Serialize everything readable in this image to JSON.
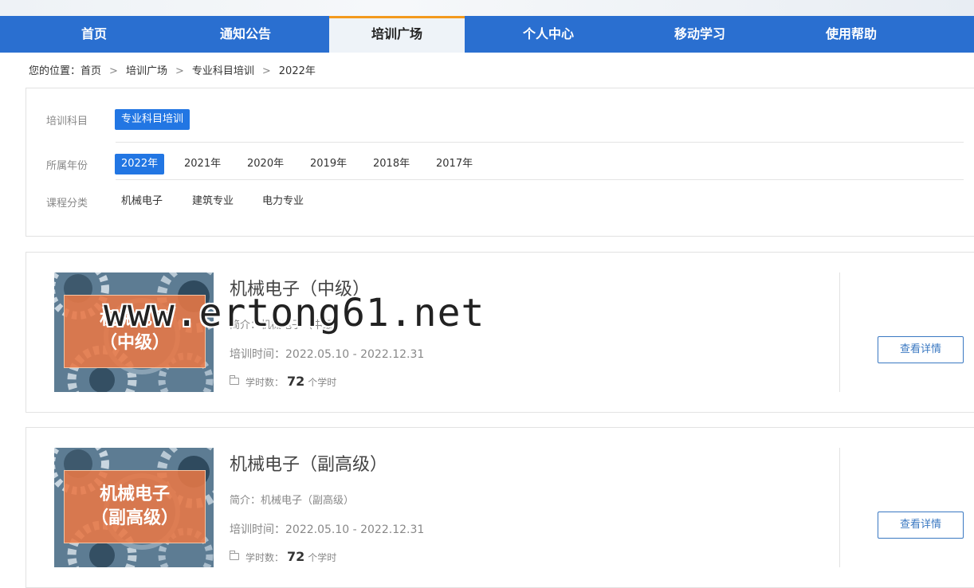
{
  "nav": {
    "items": [
      {
        "label": "首页"
      },
      {
        "label": "通知公告"
      },
      {
        "label": "培训广场"
      },
      {
        "label": "个人中心"
      },
      {
        "label": "移动学习"
      },
      {
        "label": "使用帮助"
      }
    ],
    "active_index": 2,
    "colors": {
      "bar": "#2a6fd0",
      "active_bg": "#eef3f8",
      "active_border": "#f39a1e"
    }
  },
  "breadcrumb": {
    "prefix": "您的位置：",
    "items": [
      "首页",
      "培训广场",
      "专业科目培训",
      "2022年"
    ],
    "separator": ">"
  },
  "filters": {
    "subject": {
      "label": "培训科目",
      "options": [
        "专业科目培训"
      ],
      "selected": "专业科目培训"
    },
    "year": {
      "label": "所属年份",
      "options": [
        "2022年",
        "2021年",
        "2020年",
        "2019年",
        "2018年",
        "2017年"
      ],
      "selected": "2022年"
    },
    "category": {
      "label": "课程分类",
      "options": [
        "机械电子",
        "建筑专业",
        "电力专业"
      ]
    },
    "active_color": "#2276e3"
  },
  "courses": [
    {
      "title": "机械电子（中级）",
      "thumb_line1": "机械电子",
      "thumb_line2": "（中级）",
      "desc": "简介：机械电子（中级）",
      "time": "培训时间：2022.05.10 - 2022.12.31",
      "hours_label": "学时数：",
      "hours": "72",
      "hours_unit": "个学时",
      "button": "查看详情"
    },
    {
      "title": "机械电子（副高级）",
      "thumb_line1": "机械电子",
      "thumb_line2": "（副高级）",
      "desc": "简介：机械电子（副高级）",
      "time": "培训时间：2022.05.10 - 2022.12.31",
      "hours_label": "学时数：",
      "hours": "72",
      "hours_unit": "个学时",
      "button": "查看详情"
    }
  ],
  "watermark": "www.ertong61.net",
  "icons": {
    "hours": "folder-icon",
    "thumbnail": "gears-image"
  }
}
